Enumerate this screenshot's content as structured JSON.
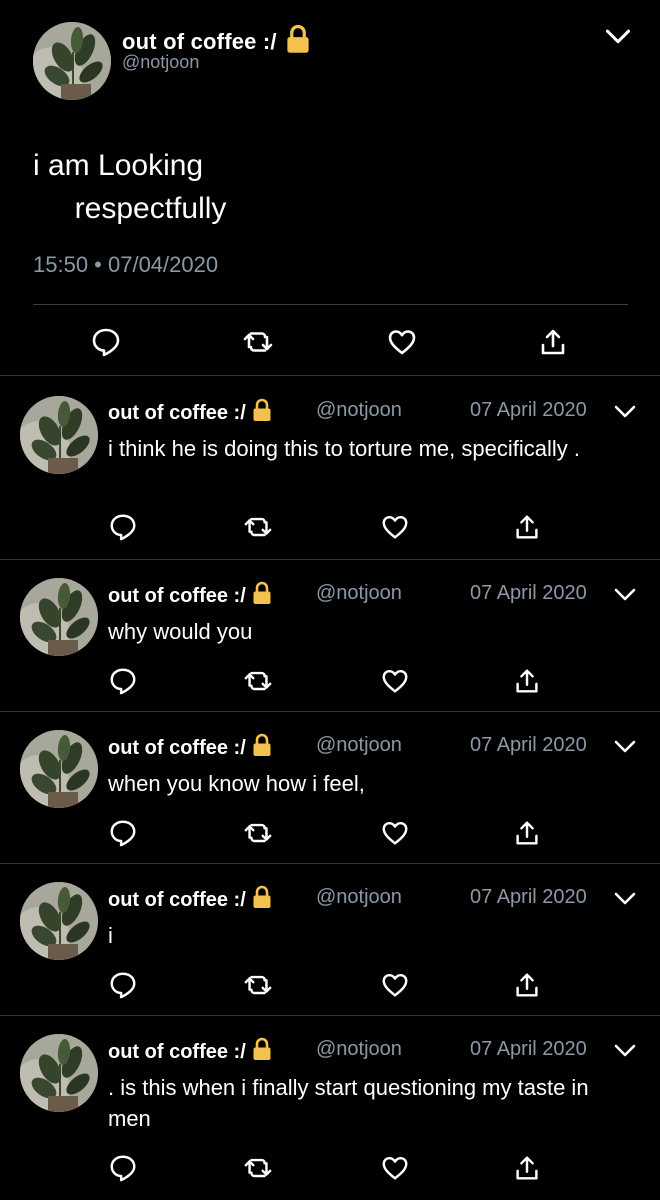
{
  "main_tweet": {
    "display_name": "out of coffee :/",
    "handle": "@notjoon",
    "text": "i am Looking\n     respectfully",
    "timestamp": "15:50 • 07/04/2020",
    "icons": [
      "lock-icon",
      "chevron-down-icon",
      "reply-icon",
      "retweet-icon",
      "like-icon",
      "share-icon"
    ]
  },
  "replies": [
    {
      "display_name": "out of coffee :/",
      "handle": "@notjoon",
      "date": "07 April 2020",
      "text": "i think he is doing this to torture me, specifically ."
    },
    {
      "display_name": "out of coffee :/",
      "handle": "@notjoon",
      "date": "07 April 2020",
      "text": "why would you"
    },
    {
      "display_name": "out of coffee :/",
      "handle": "@notjoon",
      "date": "07 April 2020",
      "text": "when you know how i feel,"
    },
    {
      "display_name": "out of coffee :/",
      "handle": "@notjoon",
      "date": "07 April 2020",
      "text": "i"
    },
    {
      "display_name": "out of coffee :/",
      "handle": "@notjoon",
      "date": "07 April 2020",
      "text": ". is this when i finally start questioning my taste in men"
    }
  ],
  "colors": {
    "background": "#000000",
    "text": "#ffffff",
    "secondary_text": "#8b98a5",
    "lock": "#f2c14e",
    "divider": "#2f3336"
  }
}
